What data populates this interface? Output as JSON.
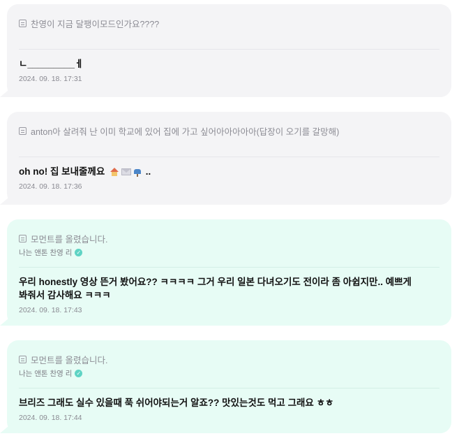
{
  "messages": [
    {
      "quote": "찬영이 지금 달팽이모드인가요????",
      "reply": "ㄴ_________ㅔ",
      "time": "2024. 09. 18. 17:31"
    },
    {
      "quote": "anton아 살려줘 난 이미 학교에 있어 집에 가고 싶어아아아아아(답장이 오기를 갈망해)",
      "reply": "oh no! 집 보내줄께요",
      "reply_suffix": "..",
      "emojis": [
        "house-icon",
        "envelope-icon",
        "mailbox-icon"
      ],
      "time": "2024. 09. 18. 17:36"
    },
    {
      "quote": "모먼트를 올렸습니다.",
      "artist": "나는 앤톤 찬영 리",
      "reply": "우리 honestly 영상 뜬거 봤어요?? ㅋㅋㅋㅋ 그거 우리 일본 다녀오기도 전이라 좀 아쉽지만.. 예쁘게 봐줘서 감사해요 ㅋㅋㅋ",
      "time": "2024. 09. 18. 17:43"
    },
    {
      "quote": "모먼트를 올렸습니다.",
      "artist": "나는 앤톤 찬영 리",
      "reply": "브리즈 그래도 실수 있을때 푹 쉬어야되는거 알죠?? 맛있는것도 먹고 그래요 ㅎㅎ",
      "time": "2024. 09. 18. 17:44"
    }
  ],
  "colors": {
    "gray_bubble": "#f4f4f6",
    "mint_bubble": "#e7fcf5",
    "verified": "#5fd3c4"
  }
}
